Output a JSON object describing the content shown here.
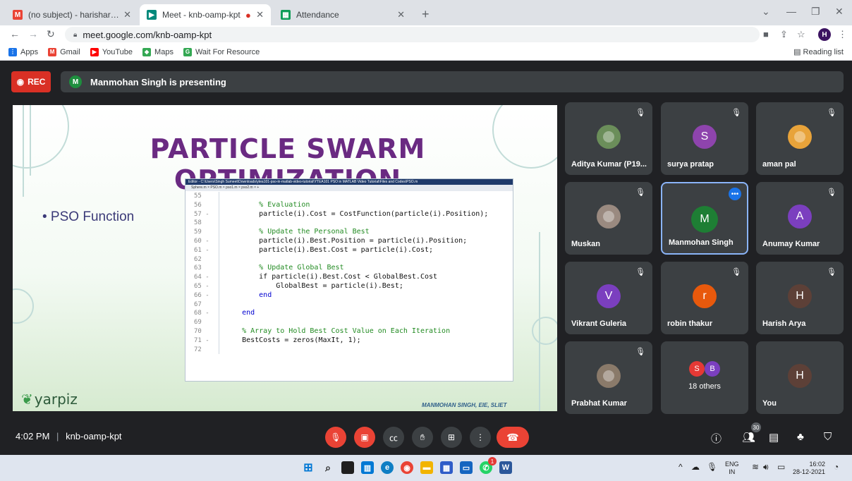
{
  "browser": {
    "tabs": [
      {
        "title": "(no subject) - harisharya@sliet.ac",
        "icon": "gmail-icon",
        "color": "#ea4335"
      },
      {
        "title": "Meet - knb-oamp-kpt",
        "icon": "meet-icon",
        "color": "#00897b"
      },
      {
        "title": "Attendance",
        "icon": "sheets-icon",
        "color": "#0f9d58"
      }
    ],
    "new_tab": "+",
    "url": "meet.google.com/knb-oamp-kpt",
    "profile_initial": "H",
    "bookmarks": [
      {
        "label": "Apps",
        "color": "#1a73e8"
      },
      {
        "label": "Gmail",
        "color": "#ea4335"
      },
      {
        "label": "YouTube",
        "color": "#ff0000"
      },
      {
        "label": "Maps",
        "color": "#34a853"
      },
      {
        "label": "Wait For Resource",
        "color": "#34a853"
      }
    ],
    "reading_list": "Reading list"
  },
  "meet": {
    "rec_label": "REC",
    "presenter_initial": "M",
    "presenting_text": "Manmohan Singh is presenting",
    "slide": {
      "title": "PARTICLE SWARM OPTIMIZATION",
      "bullet": "• PSO Function",
      "editor_path": "Editor - C:\\Users\\Singh Sumeet\\Downloads\\ytea101-pso-in-matlab-video-tutorial\\YTEA101 PSO in MATLAB Video Tutorial\\Files and Codes\\PSO.m",
      "editor_tabs": "Sphere.m  ×  PSO.m  ×  pso1.m  ×  pso2.m  ×  +",
      "code_lines": [
        {
          "n": "55",
          "t": "",
          "k": "code"
        },
        {
          "n": "56",
          "t": "        % Evaluation",
          "k": "comment"
        },
        {
          "n": "57 -",
          "t": "        particle(i).Cost = CostFunction(particle(i).Position);",
          "k": "code"
        },
        {
          "n": "58",
          "t": "",
          "k": "code"
        },
        {
          "n": "59",
          "t": "        % Update the Personal Best",
          "k": "comment"
        },
        {
          "n": "60 -",
          "t": "        particle(i).Best.Position = particle(i).Position;",
          "k": "code"
        },
        {
          "n": "61 -",
          "t": "        particle(i).Best.Cost = particle(i).Cost;",
          "k": "code"
        },
        {
          "n": "62",
          "t": "",
          "k": "code"
        },
        {
          "n": "63",
          "t": "        % Update Global Best",
          "k": "comment"
        },
        {
          "n": "64 -",
          "t": "        if particle(i).Best.Cost < GlobalBest.Cost",
          "k": "code"
        },
        {
          "n": "65 -",
          "t": "            GlobalBest = particle(i).Best;",
          "k": "code"
        },
        {
          "n": "66 -",
          "t": "        end",
          "k": "kw"
        },
        {
          "n": "67",
          "t": "",
          "k": "code"
        },
        {
          "n": "68 -",
          "t": "    end",
          "k": "kw"
        },
        {
          "n": "69",
          "t": "",
          "k": "code"
        },
        {
          "n": "70",
          "t": "    % Array to Hold Best Cost Value on Each Iteration",
          "k": "comment"
        },
        {
          "n": "71 -",
          "t": "    BestCosts = zeros(MaxIt, 1);",
          "k": "code"
        },
        {
          "n": "72",
          "t": "",
          "k": "code"
        }
      ],
      "brand": "yarpiz",
      "credit": "MANMOHAN SINGH, EIE, SLIET"
    },
    "participants": [
      {
        "name": "Aditya Kumar (P19...",
        "initial": "",
        "color": "#6b8e5a",
        "photo": true,
        "muted": true
      },
      {
        "name": "surya pratap",
        "initial": "S",
        "color": "#8e44ad",
        "photo": false,
        "muted": true
      },
      {
        "name": "aman pal",
        "initial": "",
        "color": "#e8a33a",
        "photo": true,
        "muted": true
      },
      {
        "name": "Muskan",
        "initial": "",
        "color": "#9a8a80",
        "photo": true,
        "muted": true
      },
      {
        "name": "Manmohan Singh",
        "initial": "M",
        "color": "#1e7e34",
        "photo": false,
        "muted": false,
        "active": true
      },
      {
        "name": "Anumay Kumar",
        "initial": "A",
        "color": "#7b3fbf",
        "photo": false,
        "muted": true
      },
      {
        "name": "Vikrant Guleria",
        "initial": "V",
        "color": "#7b3fbf",
        "photo": false,
        "muted": true
      },
      {
        "name": "robin thakur",
        "initial": "r",
        "color": "#e8590c",
        "photo": false,
        "muted": true
      },
      {
        "name": "Harish Arya",
        "initial": "H",
        "color": "#5d4037",
        "photo": false,
        "muted": true
      },
      {
        "name": "Prabhat Kumar",
        "initial": "",
        "color": "#8a7a6a",
        "photo": true,
        "muted": true
      },
      {
        "name": "18 others",
        "initial": "",
        "color": "",
        "photo": false,
        "muted": false,
        "others": [
          "S",
          "B"
        ]
      },
      {
        "name": "You",
        "initial": "H",
        "color": "#5d4037",
        "photo": false,
        "muted": false
      }
    ],
    "time": "4:02 PM",
    "meeting_code": "knb-oamp-kpt",
    "participant_count": "30"
  },
  "taskbar": {
    "lang_top": "ENG",
    "lang_bottom": "IN",
    "clock_time": "16:02",
    "clock_date": "28-12-2021",
    "whatsapp_badge": "1"
  }
}
